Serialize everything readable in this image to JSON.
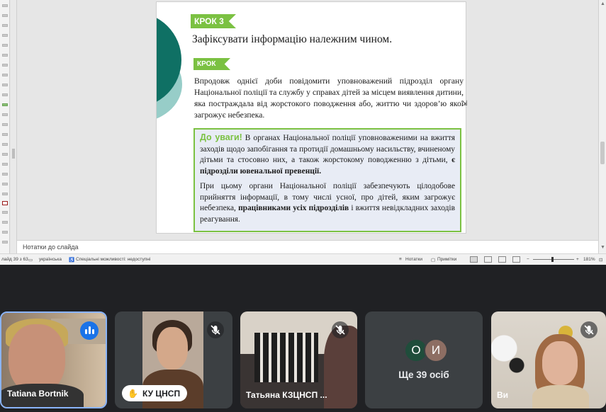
{
  "presentation": {
    "slide": {
      "step3_tag": "КРОК 3",
      "step3_text": "Зафіксувати інформацію належним чином.",
      "step4_tag": "КРОК 4",
      "step4_text": "Впродовж однієї доби повідомити уповноважений підрозділ органу Національної поліції та службу у справах дітей за місцем виявлення дитини, яка постраждала від жорстокого поводження або, життю чи здоров’ю якої загрожує небезпека.",
      "attention_label": "До уваги!",
      "attention_text_1": " В органах Національної поліції уповноваженими на вжиття заходів щодо запобігання та протидії домашньому насильству, вчиненому дітьми та стосовно них, а також жорстокому поводженню з дітьми, ",
      "attention_text_1_bold": "є підрозділи ювенальної превенції.",
      "attention_text_2": "При цьому органи Національної поліції забезпечують цілодобове прийняття інформації, в тому числі усної, про дітей, яким загрожує небезпека, ",
      "attention_text_2_bold": "працівниками усіх підрозділів",
      "attention_text_2_end": " і вжиття невідкладних заходів реагування."
    },
    "notes_placeholder": "Нотатки до слайда",
    "status_bar": {
      "slide_counter": "лайд 39 з 63",
      "language": "українська",
      "accessibility": "Спеціальні можливості: недоступні",
      "notes_button": "Нотатки",
      "comments_button": "Примітки",
      "zoom": "181%"
    }
  },
  "meeting": {
    "participants": [
      {
        "name": "Tatiana Bortnik",
        "speaking": true
      },
      {
        "name": "КУ ЦНСП",
        "hand_raised": true
      },
      {
        "name": "Татьяна КЗЦНСП ...",
        "muted": true
      },
      {
        "avatars": [
          "О",
          "И"
        ],
        "more_label": "Ще 39 осіб"
      },
      {
        "name": "Ви",
        "muted": true
      }
    ]
  },
  "colors": {
    "accent_green": "#7bc142",
    "teal": "#0f7064",
    "meeting_bg": "#202124",
    "tile_bg": "#3c4043",
    "speaking_blue": "#1a73e8"
  }
}
